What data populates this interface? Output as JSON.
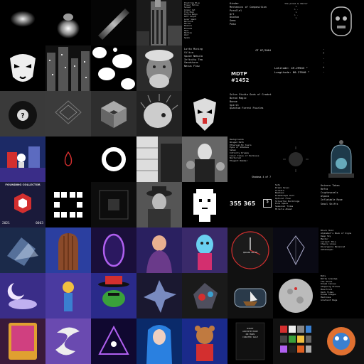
{
  "tiles": {
    "r0c5": {
      "lines": [
        "Kinder",
        "Mechanics of Composition",
        "Parallel",
        "Art",
        "Duoduo",
        "Gems",
        "Poka"
      ]
    },
    "r0c6": {
      "title": "the pixel & dancer",
      "lines": [
        "v",
        "> ·",
        "v",
        "> ·",
        "v"
      ]
    },
    "r1c5": {
      "title": "MDTP",
      "number": "#1452",
      "code": "GT 07/2064"
    },
    "r1c6": {
      "latitude": "Latitude: 49.29943 °",
      "longitude": "Longitude: 80.27840 °"
    },
    "r1c7": {
      "lines": [
        "·",
        "*",
        "·",
        "·",
        "*",
        "·"
      ]
    },
    "r2c1": {},
    "r2c2": {},
    "r2c5": {
      "lines": [
        "Solon Studio Gods of Gradation",
        "Barad Magic",
        "Bonne",
        "Spirit",
        "Quantum Forest Puzzles"
      ]
    },
    "r3c5": {
      "lines": [
        "Backgrounds",
        "Winged Path",
        "Ethereum My Years",
        "Eyes of Shadows",
        "Sehen",
        "Infinity Dreams",
        "Color Tales of Darkness",
        "Nocturnal",
        "Elegant Number"
      ]
    },
    "r3c5b": {
      "label": "Shadows",
      "value": "4 of 7"
    },
    "r4c5": {
      "counter": "355 365",
      "unit": "$"
    },
    "r4c6": {
      "lines": [
        "Sets",
        "Dream Seven",
        "Arcadia",
        "Bauhaus",
        "Dreamscape Vert",
        "Optical Flow",
        "Silverton Buildings",
        "Pure Space",
        "Seasonal Tides",
        "Miracle Ahead"
      ]
    },
    "r4c7": {
      "lines": [
        "Unicorn Token",
        "Hefra",
        "Cryptovoxels",
        "Alpaca",
        "Inflatable Rose",
        "Seoul Shifts"
      ]
    },
    "r4c0": {
      "title": "FOUNDING COLLECTOR",
      "year": "2021",
      "number": "0063"
    },
    "r5c5": {
      "brand": "QUASAR WATCH"
    },
    "r5c6": {
      "lines": [
        "Block Hold",
        "Alphabet's Book of Signs",
        "Deep Sky",
        "Mentor",
        "Collect This",
        "Chance Lines",
        "Divergence Balanced",
        "Gatekeeper"
      ]
    },
    "r6c7": {
      "lines": [
        "Bots",
        "Bitte Grandpa",
        "The Stone",
        "Dream Canvas",
        "Stepping Stones",
        "Moonfront",
        "Dark Tides",
        "Dream Stages",
        "Machines",
        "Gradient Bags"
      ]
    },
    "r0c4": {
      "lines": [
        "Pinstripe Blue",
        "Flower Hollow",
        "Sunset",
        "Ginger Cat",
        "Tiny Moon",
        "Purple Reign",
        "Gold Canyon",
        "Lunar Spark",
        "Nocturne",
        "Mortal",
        "Nowhere",
        "Blossom",
        "Haze",
        "Marbles",
        "Zest",
        "Spade"
      ]
    },
    "r1c3": {
      "lines": [
        "Lotto Mining",
        "Silica",
        "Space Nebula",
        "Infinity Tea",
        "Sandstorm",
        "Nexus Flow"
      ]
    },
    "r7c5": {
      "lines": [
        "NIGHT",
        "ARCHITECTURE",
        "ON MARS",
        "CURATED SALE"
      ]
    },
    "colors": {
      "bg": "#000000",
      "text": "#e6e6e6",
      "accent_purple": "#3a2d88",
      "accent_red": "#d32f2f",
      "accent_blue": "#2b3fa0"
    }
  }
}
